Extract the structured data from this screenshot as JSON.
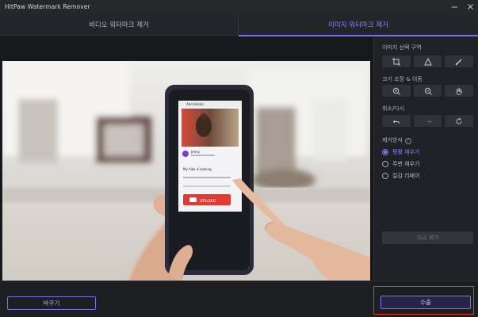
{
  "app": {
    "title": "HitPaw Watermark Remover"
  },
  "tabs": [
    {
      "label": "비디오 워터마크 제거",
      "active": false
    },
    {
      "label": "이미지 워터마크 제거",
      "active": true
    }
  ],
  "panel": {
    "selection_label": "이미지 선택 구역",
    "resize_label": "크기 조정 & 이동",
    "undo_label": "취소/다시",
    "method_label": "제거방식",
    "methods": [
      {
        "label": "평활 채우기",
        "selected": true
      },
      {
        "label": "주변 채우기",
        "selected": false
      },
      {
        "label": "질감 리페어",
        "selected": false
      }
    ],
    "remove_button": "지금 제거"
  },
  "photo": {
    "screen_user": "Jenny",
    "screen_header": "Add details",
    "screen_text": "My hike is looking",
    "screen_button": "UPLOAD"
  },
  "bottom": {
    "change_button": "바꾸기",
    "export_button": "수출"
  },
  "colors": {
    "accent": "#7b6ff0",
    "highlight": "#e23a2c",
    "background": "#1b1c20"
  }
}
